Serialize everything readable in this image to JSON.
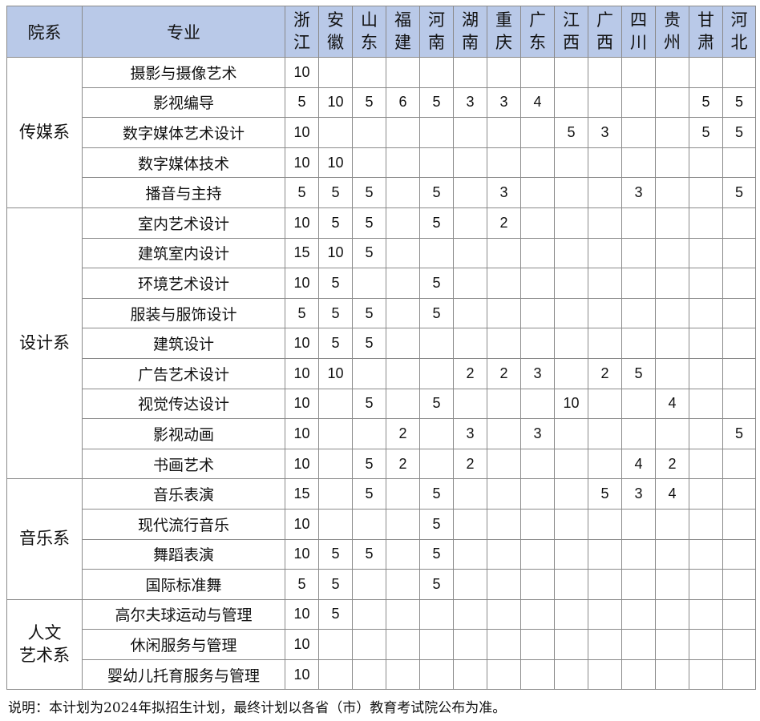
{
  "header": {
    "dept": "院系",
    "major": "专业",
    "provinces": [
      "浙江",
      "安徽",
      "山东",
      "福建",
      "河南",
      "湖南",
      "重庆",
      "广东",
      "江西",
      "广西",
      "四川",
      "贵州",
      "甘肃",
      "河北"
    ]
  },
  "departments": [
    {
      "name": "传媒系",
      "rows": [
        {
          "major": "摄影与摄像艺术",
          "values": [
            "10",
            "",
            "",
            "",
            "",
            "",
            "",
            "",
            "",
            "",
            "",
            "",
            "",
            ""
          ]
        },
        {
          "major": "影视编导",
          "values": [
            "5",
            "10",
            "5",
            "6",
            "5",
            "3",
            "3",
            "4",
            "",
            "",
            "",
            "",
            "5",
            "5"
          ]
        },
        {
          "major": "数字媒体艺术设计",
          "values": [
            "10",
            "",
            "",
            "",
            "",
            "",
            "",
            "",
            "5",
            "3",
            "",
            "",
            "5",
            "5"
          ]
        },
        {
          "major": "数字媒体技术",
          "values": [
            "10",
            "10",
            "",
            "",
            "",
            "",
            "",
            "",
            "",
            "",
            "",
            "",
            "",
            ""
          ]
        },
        {
          "major": "播音与主持",
          "values": [
            "5",
            "5",
            "5",
            "",
            "5",
            "",
            "3",
            "",
            "",
            "",
            "3",
            "",
            "",
            "5"
          ]
        }
      ]
    },
    {
      "name": "设计系",
      "rows": [
        {
          "major": "室内艺术设计",
          "values": [
            "10",
            "5",
            "5",
            "",
            "5",
            "",
            "2",
            "",
            "",
            "",
            "",
            "",
            "",
            ""
          ]
        },
        {
          "major": "建筑室内设计",
          "values": [
            "15",
            "10",
            "5",
            "",
            "",
            "",
            "",
            "",
            "",
            "",
            "",
            "",
            "",
            ""
          ]
        },
        {
          "major": "环境艺术设计",
          "values": [
            "10",
            "5",
            "",
            "",
            "5",
            "",
            "",
            "",
            "",
            "",
            "",
            "",
            "",
            ""
          ]
        },
        {
          "major": "服装与服饰设计",
          "values": [
            "5",
            "5",
            "5",
            "",
            "5",
            "",
            "",
            "",
            "",
            "",
            "",
            "",
            "",
            ""
          ]
        },
        {
          "major": "建筑设计",
          "values": [
            "10",
            "5",
            "5",
            "",
            "",
            "",
            "",
            "",
            "",
            "",
            "",
            "",
            "",
            ""
          ]
        },
        {
          "major": "广告艺术设计",
          "values": [
            "10",
            "10",
            "",
            "",
            "",
            "2",
            "2",
            "3",
            "",
            "2",
            "5",
            "",
            "",
            ""
          ]
        },
        {
          "major": "视觉传达设计",
          "values": [
            "10",
            "",
            "5",
            "",
            "5",
            "",
            "",
            "",
            "10",
            "",
            "",
            "4",
            "",
            ""
          ]
        },
        {
          "major": "影视动画",
          "values": [
            "10",
            "",
            "",
            "2",
            "",
            "3",
            "",
            "3",
            "",
            "",
            "",
            "",
            "",
            "5"
          ]
        },
        {
          "major": "书画艺术",
          "values": [
            "10",
            "",
            "5",
            "2",
            "",
            "2",
            "",
            "",
            "",
            "",
            "4",
            "2",
            "",
            ""
          ]
        }
      ]
    },
    {
      "name": "音乐系",
      "rows": [
        {
          "major": "音乐表演",
          "values": [
            "15",
            "",
            "5",
            "",
            "5",
            "",
            "",
            "",
            "",
            "5",
            "3",
            "4",
            "",
            ""
          ]
        },
        {
          "major": "现代流行音乐",
          "values": [
            "10",
            "",
            "",
            "",
            "5",
            "",
            "",
            "",
            "",
            "",
            "",
            "",
            "",
            ""
          ]
        },
        {
          "major": "舞蹈表演",
          "values": [
            "10",
            "5",
            "5",
            "",
            "5",
            "",
            "",
            "",
            "",
            "",
            "",
            "",
            "",
            ""
          ]
        },
        {
          "major": "国际标准舞",
          "values": [
            "5",
            "5",
            "",
            "",
            "5",
            "",
            "",
            "",
            "",
            "",
            "",
            "",
            "",
            ""
          ]
        }
      ]
    },
    {
      "name": "人文艺术系",
      "name_lines": [
        "人文",
        "艺术系"
      ],
      "rows": [
        {
          "major": "高尔夫球运动与管理",
          "values": [
            "10",
            "5",
            "",
            "",
            "",
            "",
            "",
            "",
            "",
            "",
            "",
            "",
            "",
            ""
          ]
        },
        {
          "major": "休闲服务与管理",
          "values": [
            "10",
            "",
            "",
            "",
            "",
            "",
            "",
            "",
            "",
            "",
            "",
            "",
            "",
            ""
          ]
        },
        {
          "major": "婴幼儿托育服务与管理",
          "values": [
            "10",
            "",
            "",
            "",
            "",
            "",
            "",
            "",
            "",
            "",
            "",
            "",
            "",
            ""
          ]
        }
      ]
    }
  ],
  "note": "说明：本计划为2024年拟招生计划，最终计划以各省（市）教育考试院公布为准。"
}
